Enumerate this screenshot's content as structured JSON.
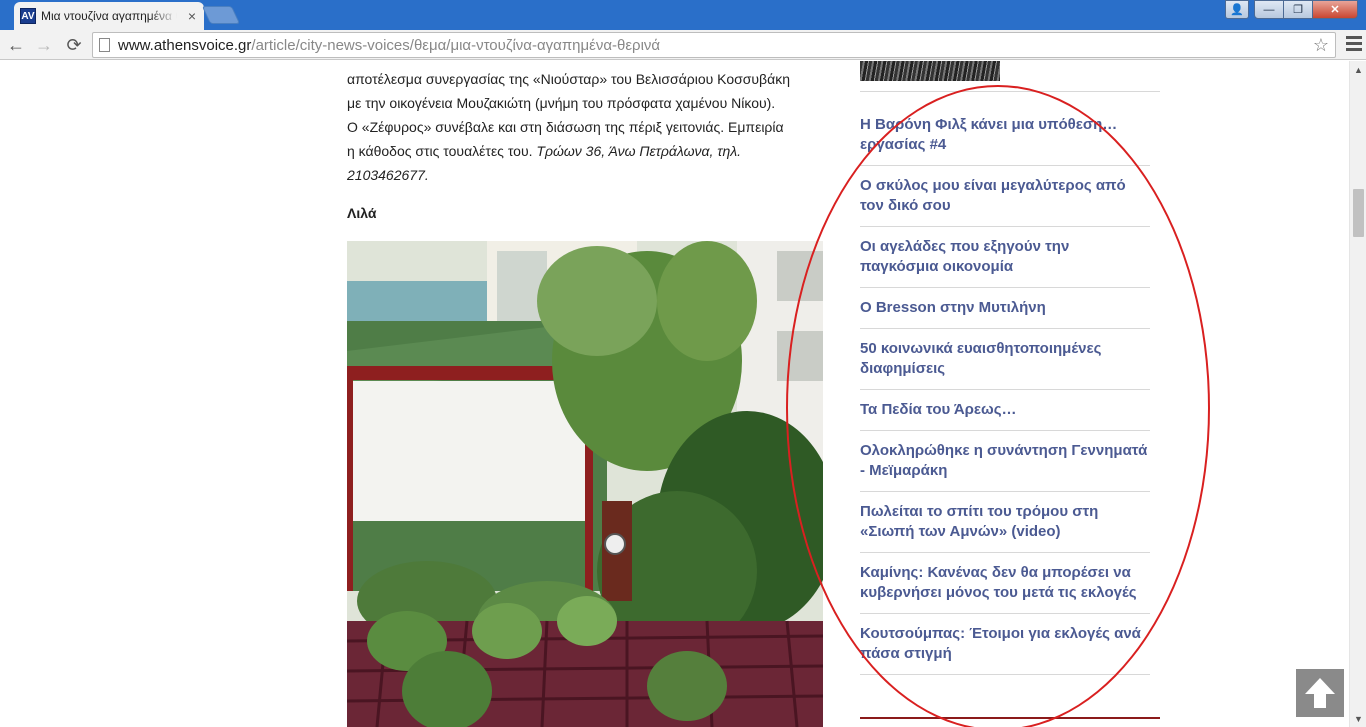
{
  "browser": {
    "tab_title": "Μια ντουζίνα αγαπημένα θερινά",
    "favicon_text": "AV",
    "url_host": "www.athensvoice.gr",
    "url_path": "/article/city-news-voices/θεμα/μια-ντουζίνα-αγαπημένα-θερινά",
    "window_controls": {
      "minimize": "—",
      "restore": "❐",
      "close": "✕"
    }
  },
  "article": {
    "line1": "αποτέλεσμα συνεργασίας της «Νιούσταρ» του Βελισσάριου Κοσσυβάκη",
    "line2": "με την οικογένεια Μουζακιώτη (μνήμη του πρόσφατα χαμένου Νίκου).",
    "line3": "Ο «Ζέφυρος» συνέβαλε και στη διάσωση της πέριξ γειτονιάς. Εμπειρία",
    "line4_plain": "η κάθοδος στις τουαλέτες του. ",
    "line4_italic": "Τρώων 36, Άνω Πετράλωνα, τηλ.",
    "line5_italic": "2103462677.",
    "subheading": "Λιλά"
  },
  "sidebar": {
    "items": [
      "Η Βαρόνη Φιλξ κάνει μια υπόθεση… εργασίας #4",
      "Ο σκύλος μου είναι μεγαλύτερος από τον δικό σου",
      "Οι αγελάδες που εξηγούν την παγκόσμια οικονομία",
      "O Bresson στην Μυτιλήνη",
      "50 κοινωνικά ευαισθητοποιημένες διαφημίσεις",
      "Τα Πεδία του Άρεως…",
      "Ολοκληρώθηκε η συνάντηση Γεννηματά - Μεϊμαράκη",
      "Πωλείται το σπίτι του τρόμου στη «Σιωπή των Αμνών» (video)",
      "Καμίνης: Κανένας δεν θα μπορέσει να κυβερνήσει μόνος του μετά τις εκλογές",
      "Κουτσούμπας: Έτοιμοι για εκλογές ανά πάσα στιγμή"
    ]
  },
  "colors": {
    "link": "#4b5a92",
    "highlight": "#d92020",
    "titlebar": "#2a6fc9"
  }
}
